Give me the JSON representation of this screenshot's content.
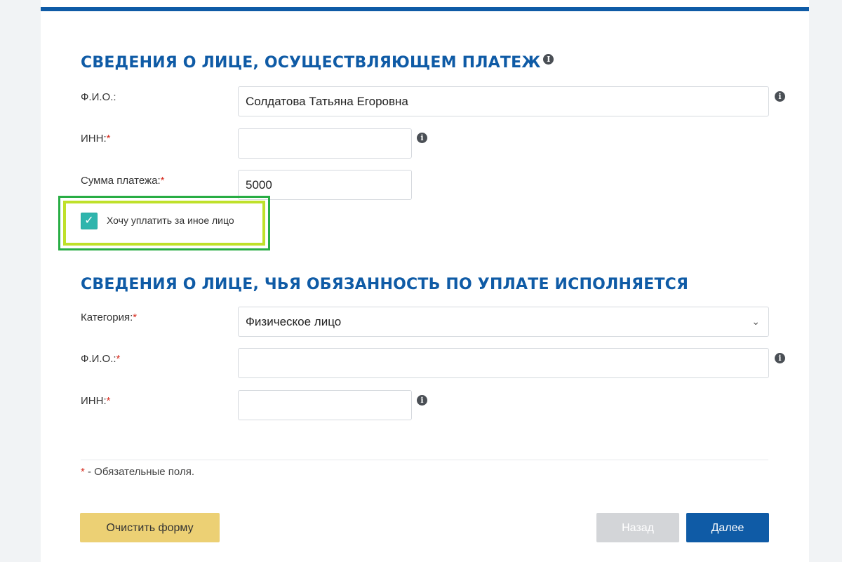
{
  "payer_section": {
    "title": "Сведения о лице, осуществляющем платеж",
    "info_icon": "info-icon",
    "fio": {
      "label": "Ф.И.О.:",
      "value": "Солдатова Татьяна Егоровна"
    },
    "inn": {
      "label": "ИНН:",
      "required_mark": "*",
      "value": ""
    },
    "amount": {
      "label": "Сумма платежа:",
      "required_mark": "*",
      "value": "5000"
    },
    "other_person_checkbox": {
      "label": "Хочу уплатить за иное лицо",
      "checked": true,
      "check_glyph": "✓"
    }
  },
  "obligor_section": {
    "title": "Сведения о лице, чья обязанность по уплате исполняется",
    "category": {
      "label": "Категория:",
      "required_mark": "*",
      "selected": "Физическое лицо",
      "arrow_glyph": "⌄"
    },
    "fio": {
      "label": "Ф.И.О.:",
      "required_mark": "*",
      "value": ""
    },
    "inn": {
      "label": "ИНН:",
      "required_mark": "*",
      "value": ""
    }
  },
  "footer": {
    "required_mark": "*",
    "required_note": " - Обязательные поля."
  },
  "buttons": {
    "clear": "Очистить форму",
    "back": "Назад",
    "next": "Далее"
  },
  "info_glyph": "i",
  "colors": {
    "brand_blue": "#0f5ba6",
    "required_red": "#d62d20",
    "checkbox_teal": "#2fb5ad",
    "clear_button_yellow": "#ecd074",
    "disabled_button_gray": "#d3d5d8",
    "highlight_green": "#28ad44",
    "highlight_lime": "#bfe12a"
  }
}
